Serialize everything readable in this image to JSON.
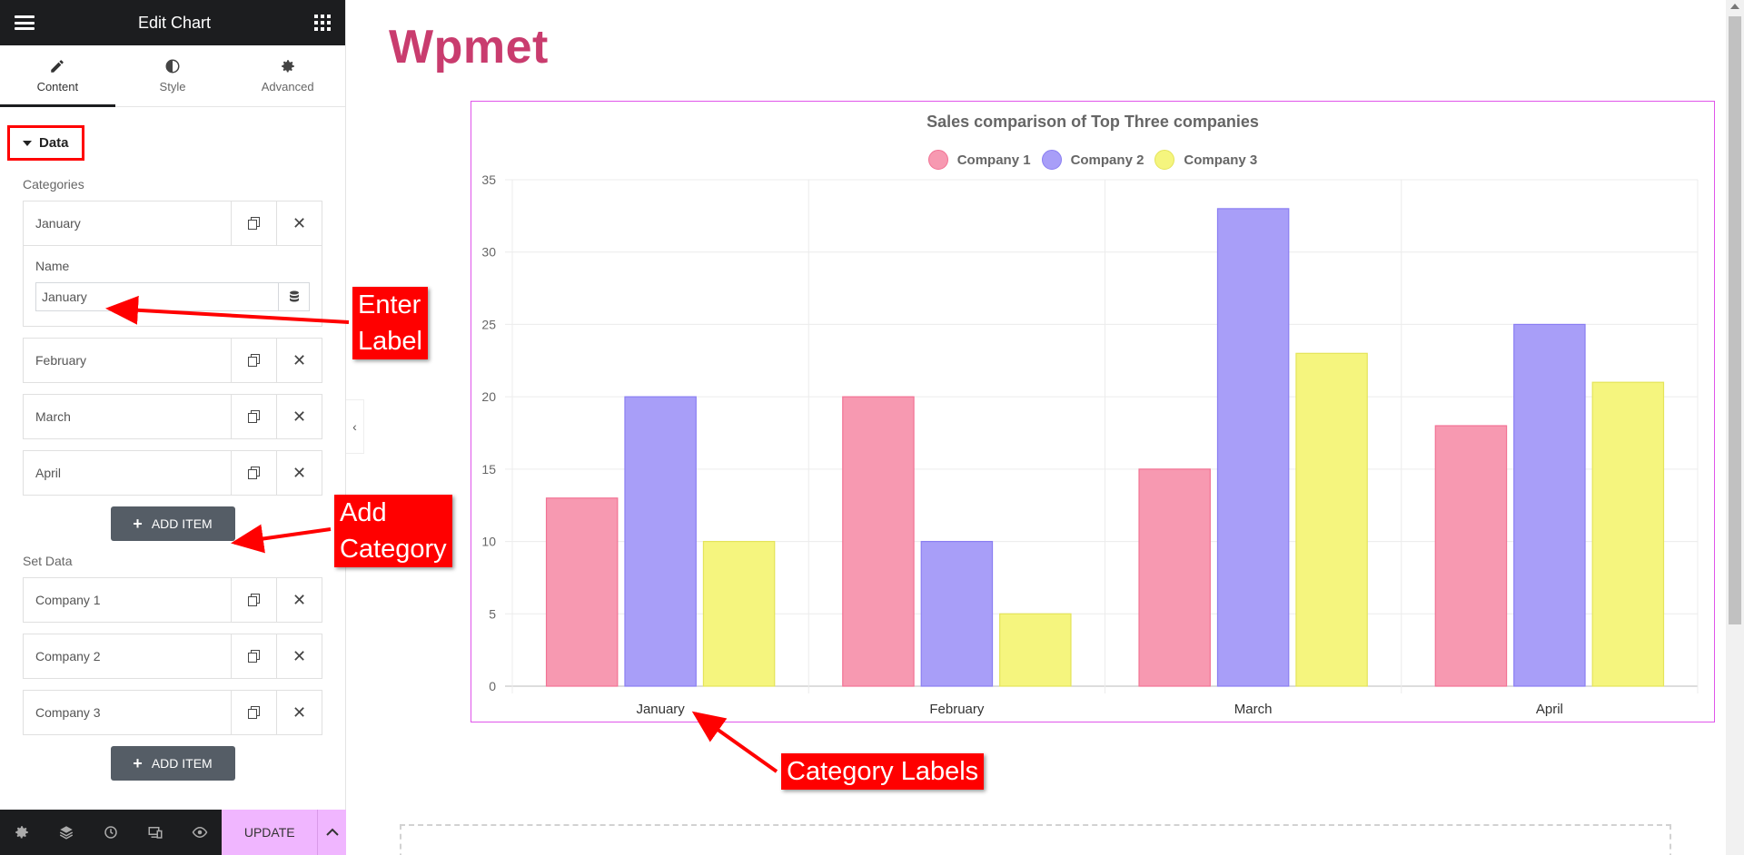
{
  "editor": {
    "title": "Edit Chart",
    "tabs": [
      {
        "label": "Content",
        "icon": "pencil-icon"
      },
      {
        "label": "Style",
        "icon": "contrast-icon"
      },
      {
        "label": "Advanced",
        "icon": "gear-icon"
      }
    ],
    "section_title": "Data",
    "categories_label": "Categories",
    "categories": [
      "January",
      "February",
      "March",
      "April"
    ],
    "name_label": "Name",
    "name_value": "January",
    "add_item_label": "ADD ITEM",
    "set_data_label": "Set Data",
    "datasets": [
      "Company 1",
      "Company 2",
      "Company 3"
    ],
    "update_label": "UPDATE"
  },
  "page": {
    "brand": "Wpmet"
  },
  "annotations": {
    "enter_label": [
      "Enter",
      "Label"
    ],
    "add_category": [
      "Add",
      "Category"
    ],
    "category_labels": "Category Labels"
  },
  "chart_data": {
    "type": "bar",
    "title": "Sales comparison of Top Three companies",
    "categories": [
      "January",
      "February",
      "March",
      "April"
    ],
    "series": [
      {
        "name": "Company 1",
        "values": [
          13,
          20,
          15,
          18
        ],
        "fill": "#f799b1",
        "stroke": "#f27294"
      },
      {
        "name": "Company 2",
        "values": [
          20,
          10,
          33,
          25
        ],
        "fill": "#a89ef8",
        "stroke": "#8a7ef2"
      },
      {
        "name": "Company 3",
        "values": [
          10,
          5,
          23,
          21
        ],
        "fill": "#f5f57e",
        "stroke": "#e4e45a"
      }
    ],
    "ylim": [
      0,
      35
    ],
    "yticks": [
      0,
      5,
      10,
      15,
      20,
      25,
      30,
      35
    ],
    "grid": true,
    "legend": "top"
  }
}
